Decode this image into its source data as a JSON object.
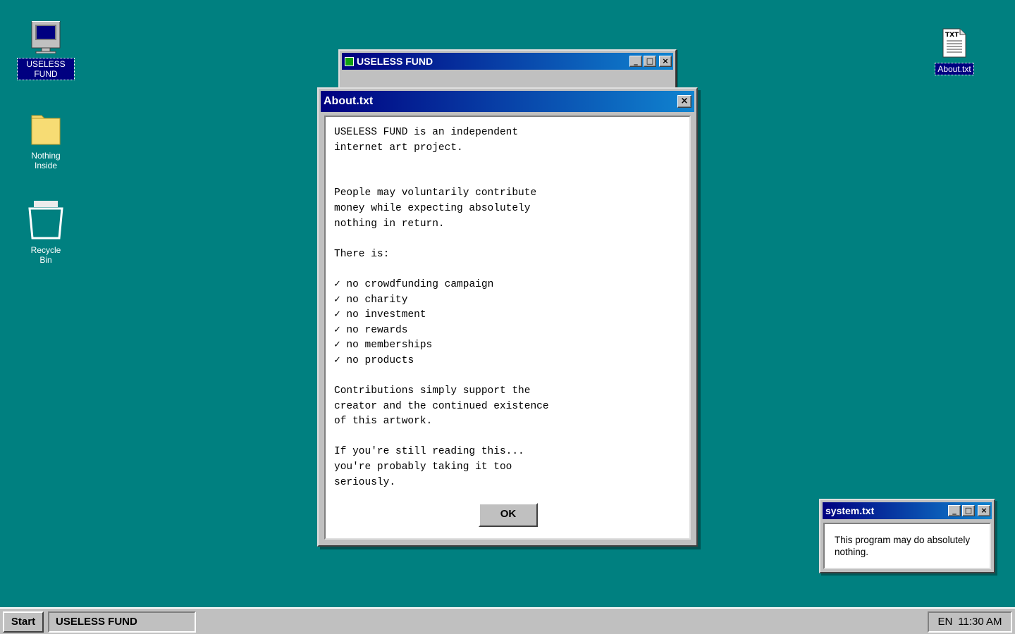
{
  "desktop": {
    "icons": [
      {
        "label": "USELESS FUND",
        "icon": "computer-icon",
        "selected": true
      },
      {
        "label": "Nothing Inside",
        "icon": "folder-icon",
        "selected": false
      },
      {
        "label": "Recycle Bin",
        "icon": "recycle-bin-icon",
        "selected": false
      },
      {
        "label": "About.txt",
        "icon": "text-file-icon",
        "selected": true,
        "badge": "TXT"
      }
    ],
    "background_color": "#008080"
  },
  "main_window": {
    "title": "USELESS FUND",
    "minimize": "_",
    "maximize": "□",
    "close": "×"
  },
  "about_window": {
    "title": "About.txt",
    "close": "×",
    "body_lines": [
      "USELESS FUND is an independent",
      "internet art project.",
      "",
      "",
      "People may voluntarily contribute",
      "money while expecting absolutely",
      "nothing in return.",
      "",
      "There is:",
      "",
      "✓ no crowdfunding campaign",
      "✓ no charity",
      "✓ no investment",
      "✓ no rewards",
      "✓ no memberships",
      "✓ no products",
      "",
      "Contributions simply support the",
      "creator and the continued existence",
      "of this artwork.",
      "",
      "If you're still reading this...",
      "you're probably taking it too",
      "seriously."
    ],
    "ok_label": "OK"
  },
  "system_window": {
    "title": "system.txt",
    "minimize": "_",
    "maximize": "□",
    "close": "×",
    "message": "This program may do absolutely nothing."
  },
  "taskbar": {
    "start_label": "Start",
    "task_label": "USELESS FUND",
    "language": "EN",
    "clock": "11:30 AM"
  },
  "colors": {
    "title_gradient_start": "#000080",
    "title_gradient_end": "#1084d0",
    "window_face": "#c0c0c0"
  }
}
